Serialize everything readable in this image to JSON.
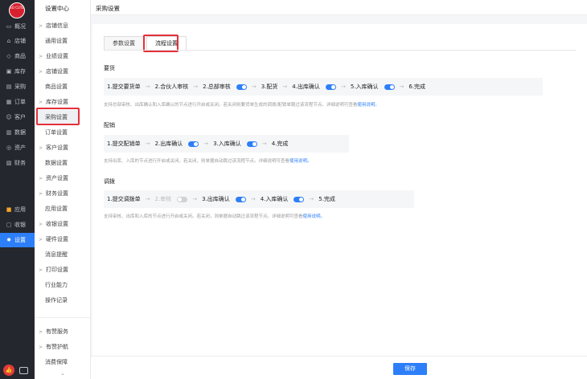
{
  "brand": {
    "logo_text": "SO CUTE"
  },
  "rail": {
    "items": [
      {
        "label": "概况",
        "icon": "monitor-icon"
      },
      {
        "label": "店铺",
        "icon": "store-icon"
      },
      {
        "label": "商品",
        "icon": "tag-icon"
      },
      {
        "label": "库存",
        "icon": "box-icon"
      },
      {
        "label": "采购",
        "icon": "bag-icon"
      },
      {
        "label": "订单",
        "icon": "order-icon"
      },
      {
        "label": "客户",
        "icon": "user-icon"
      },
      {
        "label": "数据",
        "icon": "chart-icon"
      },
      {
        "label": "资产",
        "icon": "wallet-icon"
      },
      {
        "label": "财务",
        "icon": "finance-icon"
      },
      {
        "label": "应用",
        "icon": "apps-icon"
      },
      {
        "label": "收银",
        "icon": "cashier-icon"
      },
      {
        "label": "设置",
        "icon": "gear-icon"
      }
    ],
    "active": "设置"
  },
  "subnav": {
    "title": "设置中心",
    "items": [
      {
        "label": "店铺信息",
        "group": true
      },
      {
        "label": "通用设置",
        "group": false
      },
      {
        "label": "业绩设置",
        "group": true
      },
      {
        "label": "店铺设置",
        "group": true
      },
      {
        "label": "商品设置",
        "group": false
      },
      {
        "label": "库存设置",
        "group": true
      },
      {
        "label": "采购设置",
        "group": false,
        "active": true
      },
      {
        "label": "订单设置",
        "group": false
      },
      {
        "label": "客户设置",
        "group": true
      },
      {
        "label": "数据设置",
        "group": false
      },
      {
        "label": "资产设置",
        "group": true
      },
      {
        "label": "财务设置",
        "group": true
      },
      {
        "label": "应用设置",
        "group": false
      },
      {
        "label": "收银设置",
        "group": true
      },
      {
        "label": "硬件设置",
        "group": true
      },
      {
        "label": "消息提醒",
        "group": false
      },
      {
        "label": "打印设置",
        "group": true
      },
      {
        "label": "行业能力",
        "group": false
      },
      {
        "label": "操作记录",
        "group": false
      }
    ],
    "bottom_items": [
      {
        "label": "有赞服务",
        "group": true
      },
      {
        "label": "有赞护航",
        "group": true
      },
      {
        "label": "消费保障",
        "group": false
      }
    ]
  },
  "header": {
    "title": "采购设置"
  },
  "tabs": [
    {
      "label": "参数设置",
      "active": false
    },
    {
      "label": "流程设置",
      "active": true
    }
  ],
  "sections": [
    {
      "title": "要货",
      "steps": [
        {
          "label": "1.提交要货单",
          "toggle": null
        },
        {
          "label": "2.合伙人审核",
          "toggle": null
        },
        {
          "label": "2.总部审核",
          "toggle": "on"
        },
        {
          "label": "3.配货",
          "toggle": null
        },
        {
          "label": "4.出库确认",
          "toggle": "on"
        },
        {
          "label": "5.入库确认",
          "toggle": "on"
        },
        {
          "label": "6.完成",
          "toggle": null
        }
      ],
      "note": "支持总部审核、出库确认和入库确认的节点进行开启或关闭。若关闭则要货单生成的调拨/配销单跳过该流程节点。详细说明可查看",
      "link": "使用说明。"
    },
    {
      "title": "配销",
      "steps": [
        {
          "label": "1.提交配销单",
          "toggle": null
        },
        {
          "label": "2.出库确认",
          "toggle": "on"
        },
        {
          "label": "3.入库确认",
          "toggle": "on"
        },
        {
          "label": "4.完成",
          "toggle": null
        }
      ],
      "note": "支持出库、入库的节点进行开启或关闭。若关闭，则单据自动跳过该流程节点。详细说明可查看",
      "link": "使用说明。"
    },
    {
      "title": "调拨",
      "steps": [
        {
          "label": "1.提交调拨单",
          "toggle": null
        },
        {
          "label": "2.审核",
          "toggle": "off",
          "disabled": true
        },
        {
          "label": "3.出库确认",
          "toggle": "on"
        },
        {
          "label": "4.入库确认",
          "toggle": "on"
        },
        {
          "label": "5.完成",
          "toggle": null
        }
      ],
      "note": "支持审核、出库和入库的节点进行开启或关闭。若关闭，则单据自动跳过该流程节点。详细说明可查看",
      "link": "使用说明。"
    }
  ],
  "footer": {
    "save_label": "保存"
  },
  "colors": {
    "accent": "#2d7ff9",
    "highlight": "#e5303a",
    "rail": "#25272e"
  }
}
